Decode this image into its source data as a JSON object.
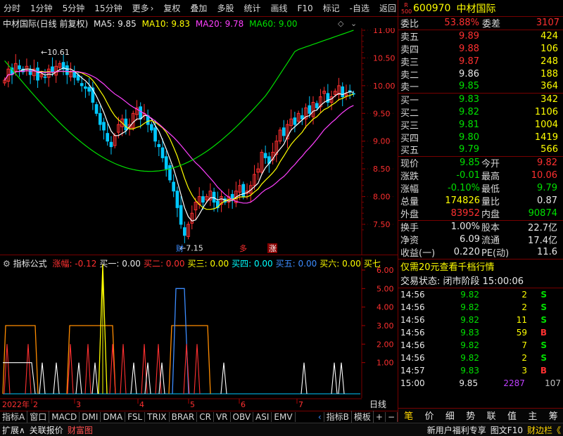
{
  "toolbar": {
    "left": [
      "分时",
      "1分钟",
      "5分钟",
      "15分钟",
      "更多"
    ],
    "right": [
      "复权",
      "叠加",
      "多股",
      "统计",
      "画线",
      "F10",
      "标记",
      "-自选",
      "返回"
    ],
    "more_arrow": "›"
  },
  "chart": {
    "title": "中材国际(日线 前复权)",
    "ma5": "MA5: 9.85",
    "ma10": "MA10: 9.83",
    "ma20": "MA20: 9.78",
    "ma60": "MA60: 9.00",
    "price_axis": [
      "11.00",
      "10.50",
      "10.00",
      "9.50",
      "9.00",
      "8.50",
      "8.00",
      "7.50"
    ],
    "high_label": "10.61",
    "low_label": "7.15",
    "markers": [
      "财",
      "多",
      "涨"
    ],
    "colors": {
      "up": "#ff3030",
      "down": "#00c8ff",
      "ma5": "#ffffff",
      "ma10": "#ffff00",
      "ma20": "#ff40ff",
      "ma60": "#00e000"
    }
  },
  "indicator": {
    "title": "指标公式",
    "items": [
      {
        "label": "涨幅: -0.12",
        "color": "#ff3030"
      },
      {
        "label": "买一: 0.00",
        "color": "#e8e8e8"
      },
      {
        "label": "买二: 0.00",
        "color": "#ff3030"
      },
      {
        "label": "买三: 0.00",
        "color": "#ffff00"
      },
      {
        "label": "买四: 0.00",
        "color": "#00ffff"
      },
      {
        "label": "买五: 0.00",
        "color": "#3c8cff"
      },
      {
        "label": "买六: 0.00",
        "color": "#ffff00"
      },
      {
        "label": "买七",
        "color": "#ffff00"
      }
    ],
    "axis": [
      "6.00",
      "5.00",
      "4.00",
      "3.00",
      "2.00",
      "1.00"
    ]
  },
  "date_axis": {
    "year": "2022年",
    "months": [
      "2",
      "3",
      "4",
      "5",
      "6",
      "7"
    ],
    "period": "日线"
  },
  "bottom_tabs": [
    "指标A",
    "窗口",
    "MACD",
    "DMI",
    "DMA",
    "FSL",
    "TRIX",
    "BRAR",
    "CR",
    "VR",
    "OBV",
    "ASI",
    "EMV",
    "‹",
    "指标B",
    "模板",
    "+",
    "−"
  ],
  "status_bar": [
    "扩展∧",
    "关联报价",
    "财富图",
    "新用户福利专享",
    "图文F10",
    "财边栏《"
  ],
  "quote": {
    "code": "600970",
    "name": "中材国际",
    "badge": "R 500",
    "weibi_label": "委比",
    "weibi": "53.88%",
    "weicha_label": "委差",
    "weicha": "3107",
    "asks": [
      {
        "label": "卖五",
        "price": "9.89",
        "vol": "424"
      },
      {
        "label": "卖四",
        "price": "9.88",
        "vol": "106"
      },
      {
        "label": "卖三",
        "price": "9.87",
        "vol": "248"
      },
      {
        "label": "卖二",
        "price": "9.86",
        "vol": "188"
      },
      {
        "label": "卖一",
        "price": "9.85",
        "vol": "364"
      }
    ],
    "bids": [
      {
        "label": "买一",
        "price": "9.83",
        "vol": "342"
      },
      {
        "label": "买二",
        "price": "9.82",
        "vol": "1106"
      },
      {
        "label": "买三",
        "price": "9.81",
        "vol": "1004"
      },
      {
        "label": "买四",
        "price": "9.80",
        "vol": "1419"
      },
      {
        "label": "买五",
        "price": "9.79",
        "vol": "566"
      }
    ],
    "stats1": [
      {
        "k": "现价",
        "v": "9.85",
        "k2": "今开",
        "v2": "9.82"
      },
      {
        "k": "涨跌",
        "v": "-0.01",
        "k2": "最高",
        "v2": "10.06"
      },
      {
        "k": "涨幅",
        "v": "-0.10%",
        "k2": "最低",
        "v2": "9.79"
      },
      {
        "k": "总量",
        "v": "174826",
        "k2": "量比",
        "v2": "0.87"
      },
      {
        "k": "外盘",
        "v": "83952",
        "k2": "内盘",
        "v2": "90874"
      }
    ],
    "stats2": [
      {
        "k": "换手",
        "v": "1.00%",
        "k2": "股本",
        "v2": "22.7亿"
      },
      {
        "k": "净资",
        "v": "6.09",
        "k2": "流通",
        "v2": "17.4亿"
      },
      {
        "k": "收益(一)",
        "v": "0.220",
        "k2": "PE(动)",
        "v2": "11.6"
      }
    ],
    "promo": "仅需20元查看千档行情",
    "trade_state": "交易状态: 闭市阶段 15:00:06",
    "ticks": [
      {
        "t": "14:56",
        "p": "9.82",
        "v": "2",
        "bs": "S"
      },
      {
        "t": "14:56",
        "p": "9.82",
        "v": "2",
        "bs": "S"
      },
      {
        "t": "14:56",
        "p": "9.82",
        "v": "11",
        "bs": "S"
      },
      {
        "t": "14:56",
        "p": "9.83",
        "v": "59",
        "bs": "B"
      },
      {
        "t": "14:56",
        "p": "9.82",
        "v": "7",
        "bs": "S"
      },
      {
        "t": "14:56",
        "p": "9.82",
        "v": "2",
        "bs": "S"
      },
      {
        "t": "14:57",
        "p": "9.83",
        "v": "3",
        "bs": "B"
      },
      {
        "t": "15:00",
        "p": "9.85",
        "v": "2287",
        "bs": "",
        "last": "107"
      }
    ],
    "buttons": [
      "笔",
      "价",
      "细",
      "势",
      "联",
      "值",
      "主",
      "筹"
    ]
  }
}
